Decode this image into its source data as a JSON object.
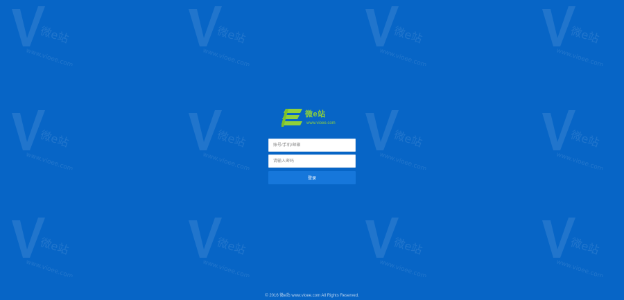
{
  "brand": {
    "name": "微e站",
    "url": "www.vioee.com",
    "accent_color": "#8fd13a",
    "logo_icon": "stacked-e-logo-icon"
  },
  "login": {
    "username_placeholder": "账号/手机/邮箱",
    "password_placeholder": "请输入密码",
    "submit_label": "登录",
    "button_color": "#1677db"
  },
  "background": {
    "color": "#0765c6",
    "watermark_text": "微e站",
    "watermark_url": "www.vioee.com"
  },
  "footer": {
    "text": "© 2016 微e站 www.vioee.com All Rights Reserved."
  }
}
